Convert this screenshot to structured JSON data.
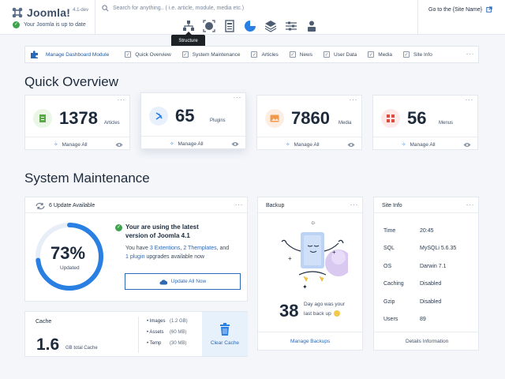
{
  "header": {
    "brand_name": "Joomla!",
    "version": "4.1-dev",
    "status_text": "Your Joomla is up to date",
    "search_placeholder": "Search for anything.. ( i.e. article, module, media etc.)",
    "go_to_site": "Go to the {Site Name}",
    "tooltip": "Structure"
  },
  "module_bar": {
    "manage_label": "Manage Dashboard Module",
    "items": [
      "Quick Overview",
      "System Maintenance",
      "Articles",
      "News",
      "User Data",
      "Media",
      "Site Info"
    ]
  },
  "quick_overview": {
    "title": "Quick Overview",
    "manage_label": "Manage All",
    "stats": [
      {
        "value": "1378",
        "label": "Articles",
        "color": "#eaf6e6",
        "icon": "article-icon"
      },
      {
        "value": "65",
        "label": "Plugins",
        "color": "#e8f1fb",
        "icon": "plugin-icon"
      },
      {
        "value": "7860",
        "label": "Media",
        "color": "#fdeee3",
        "icon": "media-icon"
      },
      {
        "value": "56",
        "label": "Menus",
        "color": "#fde9e8",
        "icon": "menu-icon"
      }
    ]
  },
  "system_maintenance": {
    "title": "System Maintenance",
    "update": {
      "header": "6 Update Available",
      "percent": "73%",
      "percent_value": 73,
      "percent_label": "Updated",
      "latest_line1": "Your are using the latest",
      "latest_line2": "version of Joomla 4.1",
      "you_have": "You have",
      "extensions_link": "3 Extentions",
      "comma": ",",
      "templates_link": "2 Themplates",
      "and": ", and",
      "plugin_link": "1 plugin",
      "tail": "upgrades available now",
      "button": "Update All Now"
    },
    "backup": {
      "title": "Backup",
      "days": "38",
      "caption_line1": "Day ago was your",
      "caption_line2": "last back up",
      "button": "Manage Backups"
    },
    "site_info": {
      "title": "Site Info",
      "rows": [
        {
          "k": "Time",
          "v": "20:45"
        },
        {
          "k": "SQL",
          "v": "MySQLi 5.6.35"
        },
        {
          "k": "OS",
          "v": "Darwin 7.1"
        },
        {
          "k": "Caching",
          "v": "Disabled"
        },
        {
          "k": "Gzip",
          "v": "Disabled"
        },
        {
          "k": "Users",
          "v": "89"
        }
      ],
      "button": "Details Information"
    },
    "cache": {
      "title": "Cache",
      "value": "1.6",
      "unit": "GB total Cache",
      "items": [
        {
          "name": "• Images",
          "size": "(1.2 GB)"
        },
        {
          "name": "• Assets",
          "size": "(60 MB)"
        },
        {
          "name": "• Temp",
          "size": "(30 MB)"
        }
      ],
      "clear": "Clear Cache"
    }
  },
  "colors": {
    "accent": "#2b68b6",
    "ring": "#2a7fe3",
    "success": "#3fa34d"
  }
}
